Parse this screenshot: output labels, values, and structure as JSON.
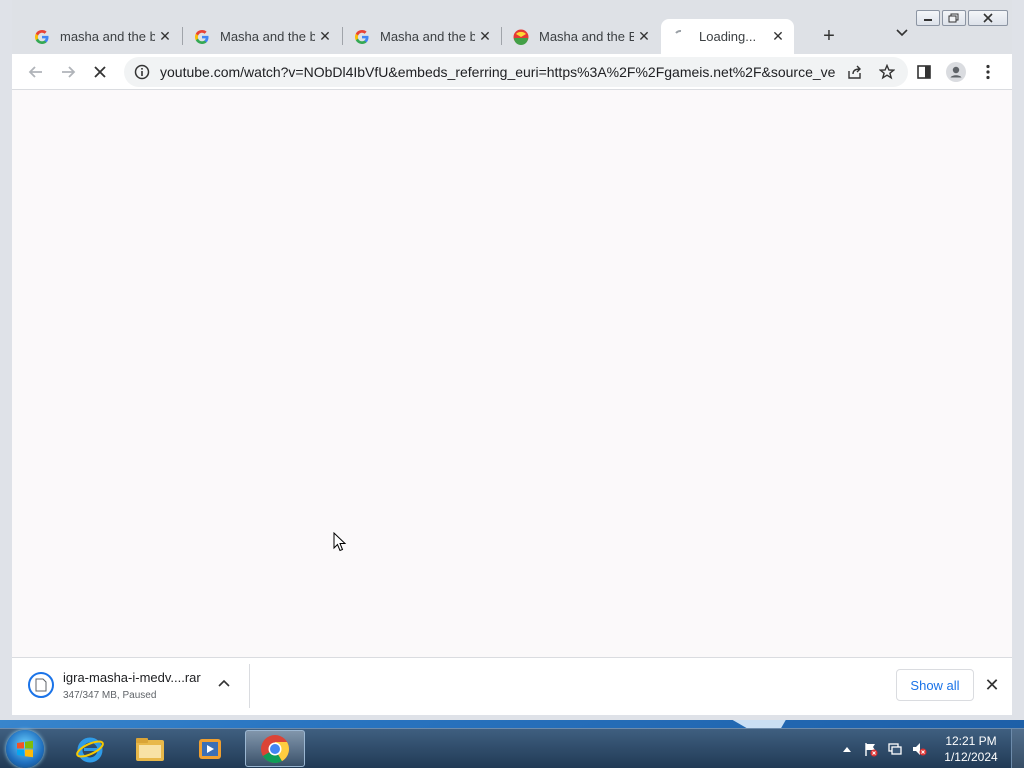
{
  "browser": {
    "tabs": [
      {
        "title": "masha and the be",
        "favicon": "google-g-icon"
      },
      {
        "title": "Masha and the be",
        "favicon": "google-g-icon"
      },
      {
        "title": "Masha and the be",
        "favicon": "google-g-icon"
      },
      {
        "title": "Masha and the Be",
        "favicon": "multicolor-ball-icon"
      },
      {
        "title": "Loading...",
        "favicon": "loading-spinner-icon",
        "active": true
      }
    ],
    "url": "youtube.com/watch?v=NObDl4IbVfU&embeds_referring_euri=https%3A%2F%2Fgameis.net%2F&source_ve...",
    "loading": true
  },
  "download": {
    "filename": "igra-masha-i-medv....rar",
    "status": "347/347 MB, Paused",
    "show_all_label": "Show all"
  },
  "taskbar": {
    "apps": [
      "internet-explorer",
      "windows-explorer",
      "media-player",
      "google-chrome"
    ],
    "active_app": "google-chrome",
    "time": "12:21 PM",
    "date": "1/12/2024"
  },
  "colors": {
    "accent": "#1a73e8",
    "tabstrip": "#dee1e6",
    "content_bg": "#fbf9fa"
  }
}
